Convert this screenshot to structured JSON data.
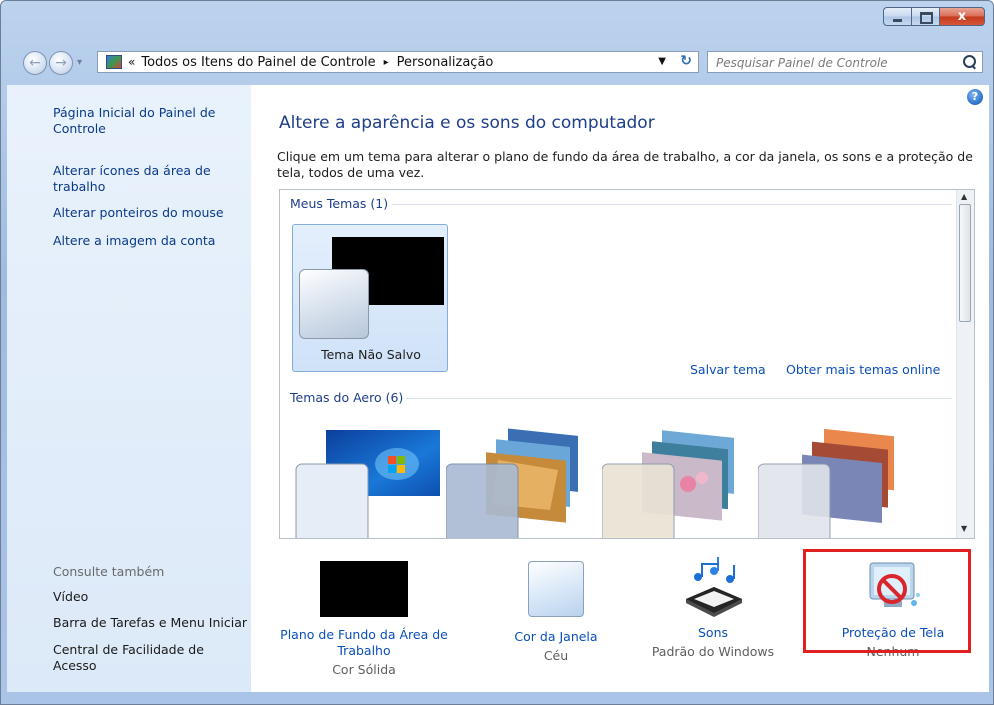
{
  "window": {
    "close_label": "x"
  },
  "navigation": {
    "breadcrumb_chevron": "«",
    "crumbs": [
      "Todos os Itens do Painel de Controle",
      "Personalização"
    ],
    "separator": "▸",
    "search_placeholder": "Pesquisar Painel de Controle"
  },
  "sidebar": {
    "links": [
      "Página Inicial do Painel de Controle",
      "Alterar ícones da área de trabalho",
      "Alterar ponteiros do mouse",
      "Altere a imagem da conta"
    ],
    "see_also_title": "Consulte também",
    "see_also": [
      "Vídeo",
      "Barra de Tarefas e Menu Iniciar",
      "Central de Facilidade de Acesso"
    ]
  },
  "main": {
    "help_label": "?",
    "title": "Altere a aparência e os sons do computador",
    "description": "Clique em um tema para alterar o plano de fundo da área de trabalho, a cor da janela, os sons e a proteção de tela, todos de uma vez.",
    "my_themes_header": "Meus Temas (1)",
    "unsaved_theme_label": "Tema Não Salvo",
    "save_theme_link": "Salvar tema",
    "more_themes_link": "Obter mais temas online",
    "aero_themes_header": "Temas do Aero (6)"
  },
  "bottom": {
    "desktop_background": {
      "label": "Plano de Fundo da Área de Trabalho",
      "value": "Cor Sólida"
    },
    "window_color": {
      "label": "Cor da Janela",
      "value": "Céu"
    },
    "sounds": {
      "label": "Sons",
      "value": "Padrão do Windows"
    },
    "screen_saver": {
      "label": "Proteção de Tela",
      "value": "Nenhum"
    }
  },
  "colors": {
    "highlight": "#e02020",
    "link": "#0b4fb8",
    "title": "#1e3e8a"
  }
}
